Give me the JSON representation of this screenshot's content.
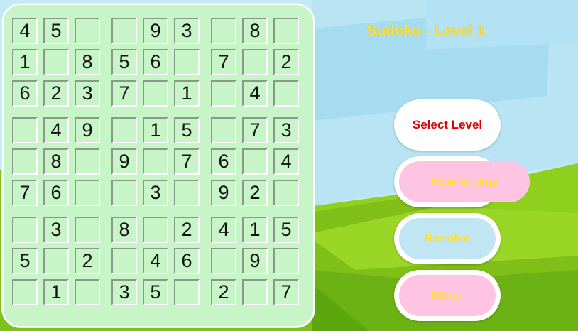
{
  "title": "Sudoku - Level 1",
  "buttons": {
    "select_level": "Select Level",
    "how_to_play": "How to play",
    "resolve": "Resolve",
    "menu": "Menu"
  },
  "grid": [
    [
      "4",
      "5",
      "",
      "",
      "9",
      "3",
      "",
      "8",
      ""
    ],
    [
      "1",
      "",
      "8",
      "5",
      "6",
      "",
      "7",
      "",
      "2"
    ],
    [
      "6",
      "2",
      "3",
      "7",
      "",
      "1",
      "",
      "4",
      ""
    ],
    [
      "",
      "4",
      "9",
      "",
      "1",
      "5",
      "",
      "7",
      "3"
    ],
    [
      "",
      "8",
      "",
      "9",
      "",
      "7",
      "6",
      "",
      "4"
    ],
    [
      "7",
      "6",
      "",
      "",
      "3",
      "",
      "9",
      "2",
      ""
    ],
    [
      "",
      "3",
      "",
      "8",
      "",
      "2",
      "4",
      "1",
      "5"
    ],
    [
      "5",
      "",
      "2",
      "",
      "4",
      "6",
      "",
      "9",
      ""
    ],
    [
      "",
      "1",
      "",
      "3",
      "5",
      "",
      "2",
      "",
      "7"
    ]
  ],
  "colors": {
    "title": "#ffe030",
    "select_level_text": "#e00000",
    "board": "#c8f5c8",
    "sky": "#a8def0",
    "grass": "#8fd01e"
  }
}
